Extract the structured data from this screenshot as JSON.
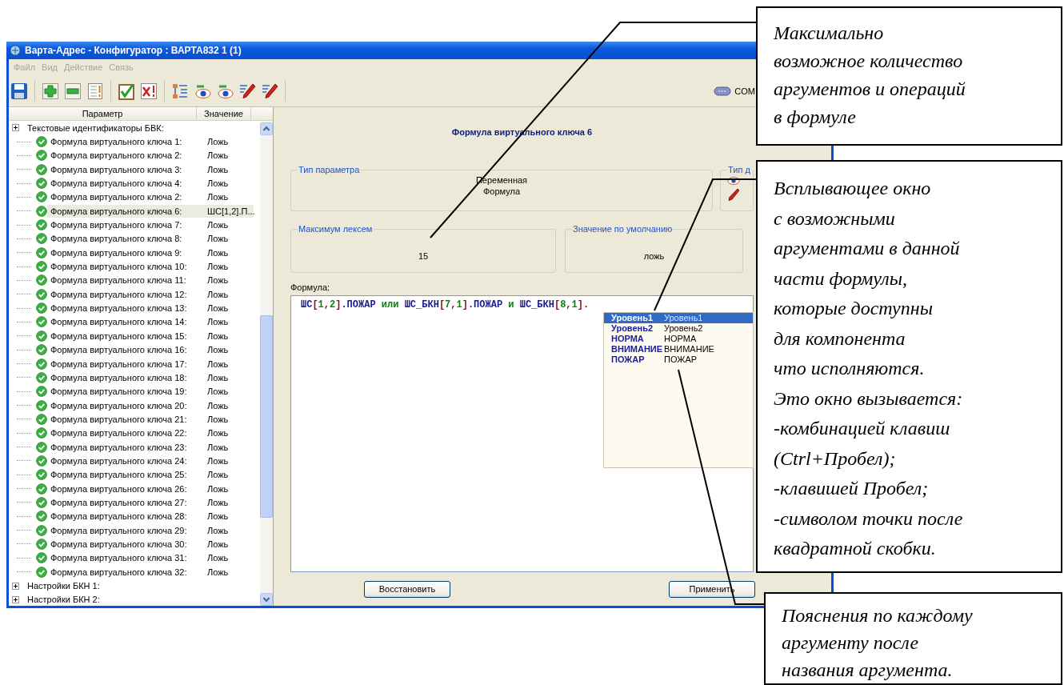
{
  "window": {
    "title": "Варта-Адрес - Конфигуратор : ВАРТА832 1 (1)"
  },
  "menu": [
    {
      "label": "Файл",
      "disabled": true
    },
    {
      "label": "Вид",
      "disabled": true
    },
    {
      "label": "Действие",
      "disabled": true
    },
    {
      "label": "Связь",
      "disabled": true
    }
  ],
  "toolbar": {
    "port": "COM"
  },
  "tree": {
    "columns": [
      "Параметр",
      "Значение"
    ],
    "rows": [
      {
        "kind": "group",
        "label": "Текстовые идентификаторы БВК:",
        "expanded": false
      },
      {
        "kind": "key",
        "label": "Формула виртуального ключа 1:",
        "value": "Ложь",
        "selected": false
      },
      {
        "kind": "key",
        "label": "Формула виртуального ключа 2:",
        "value": "Ложь",
        "selected": false
      },
      {
        "kind": "key",
        "label": "Формула виртуального ключа 3:",
        "value": "Ложь",
        "selected": false
      },
      {
        "kind": "key",
        "label": "Формула виртуального ключа 4:",
        "value": "Ложь",
        "selected": false
      },
      {
        "kind": "key",
        "label": "Формула виртуального ключа 2:",
        "value": "Ложь",
        "selected": false
      },
      {
        "kind": "key",
        "label": "Формула виртуального ключа 6:",
        "value": "ШС[1,2].П...",
        "selected": true
      },
      {
        "kind": "key",
        "label": "Формула виртуального ключа 7:",
        "value": "Ложь",
        "selected": false
      },
      {
        "kind": "key",
        "label": "Формула виртуального ключа 8:",
        "value": "Ложь",
        "selected": false
      },
      {
        "kind": "key",
        "label": "Формула виртуального ключа 9:",
        "value": "Ложь",
        "selected": false
      },
      {
        "kind": "key",
        "label": "Формула виртуального ключа 10:",
        "value": "Ложь",
        "selected": false
      },
      {
        "kind": "key",
        "label": "Формула виртуального ключа 11:",
        "value": "Ложь",
        "selected": false
      },
      {
        "kind": "key",
        "label": "Формула виртуального ключа 12:",
        "value": "Ложь",
        "selected": false
      },
      {
        "kind": "key",
        "label": "Формула виртуального ключа 13:",
        "value": "Ложь",
        "selected": false
      },
      {
        "kind": "key",
        "label": "Формула виртуального ключа 14:",
        "value": "Ложь",
        "selected": false
      },
      {
        "kind": "key",
        "label": "Формула виртуального ключа 15:",
        "value": "Ложь",
        "selected": false
      },
      {
        "kind": "key",
        "label": "Формула виртуального ключа 16:",
        "value": "Ложь",
        "selected": false
      },
      {
        "kind": "key",
        "label": "Формула виртуального ключа 17:",
        "value": "Ложь",
        "selected": false
      },
      {
        "kind": "key",
        "label": "Формула виртуального ключа 18:",
        "value": "Ложь",
        "selected": false
      },
      {
        "kind": "key",
        "label": "Формула виртуального ключа 19:",
        "value": "Ложь",
        "selected": false
      },
      {
        "kind": "key",
        "label": "Формула виртуального ключа 20:",
        "value": "Ложь",
        "selected": false
      },
      {
        "kind": "key",
        "label": "Формула виртуального ключа 21:",
        "value": "Ложь",
        "selected": false
      },
      {
        "kind": "key",
        "label": "Формула виртуального ключа 22:",
        "value": "Ложь",
        "selected": false
      },
      {
        "kind": "key",
        "label": "Формула виртуального ключа 23:",
        "value": "Ложь",
        "selected": false
      },
      {
        "kind": "key",
        "label": "Формула виртуального ключа 24:",
        "value": "Ложь",
        "selected": false
      },
      {
        "kind": "key",
        "label": "Формула виртуального ключа 25:",
        "value": "Ложь",
        "selected": false
      },
      {
        "kind": "key",
        "label": "Формула виртуального ключа 26:",
        "value": "Ложь",
        "selected": false
      },
      {
        "kind": "key",
        "label": "Формула виртуального ключа 27:",
        "value": "Ложь",
        "selected": false
      },
      {
        "kind": "key",
        "label": "Формула виртуального ключа 28:",
        "value": "Ложь",
        "selected": false
      },
      {
        "kind": "key",
        "label": "Формула виртуального ключа 29:",
        "value": "Ложь",
        "selected": false
      },
      {
        "kind": "key",
        "label": "Формула виртуального ключа 30:",
        "value": "Ложь",
        "selected": false
      },
      {
        "kind": "key",
        "label": "Формула виртуального ключа 31:",
        "value": "Ложь",
        "selected": false
      },
      {
        "kind": "key",
        "label": "Формула виртуального ключа 32:",
        "value": "Ложь",
        "selected": false
      },
      {
        "kind": "group",
        "label": "Настройки БКН 1:",
        "expanded": false
      },
      {
        "kind": "group",
        "label": "Настройки БКН 2:",
        "expanded": false
      }
    ]
  },
  "editor": {
    "heading": "Формула виртуального ключа 6",
    "param_type": {
      "label": "Тип параметра",
      "value": "Переменная\nФормула"
    },
    "access_type": {
      "label": "Тип д"
    },
    "max_tokens": {
      "label": "Максимум лексем",
      "value": "15"
    },
    "default_value": {
      "label": "Значение по умолчанию",
      "value": "ложь"
    },
    "formula": {
      "label": "Формула:",
      "tokens": [
        {
          "text": "ШС",
          "kind": "ident"
        },
        {
          "text": "[",
          "kind": "punct"
        },
        {
          "text": "1",
          "kind": "number"
        },
        {
          "text": ",",
          "kind": "punct"
        },
        {
          "text": "2",
          "kind": "number"
        },
        {
          "text": "]",
          "kind": "punct"
        },
        {
          "text": ".ПОЖАР",
          "kind": "ident"
        },
        {
          "text": " или ",
          "kind": "keyword"
        },
        {
          "text": "ШС_БКН",
          "kind": "ident"
        },
        {
          "text": "[",
          "kind": "punct"
        },
        {
          "text": "7",
          "kind": "number"
        },
        {
          "text": ",",
          "kind": "punct"
        },
        {
          "text": "1",
          "kind": "number"
        },
        {
          "text": "]",
          "kind": "punct"
        },
        {
          "text": ".ПОЖАР",
          "kind": "ident"
        },
        {
          "text": " и ",
          "kind": "keyword"
        },
        {
          "text": "ШС_БКН",
          "kind": "ident"
        },
        {
          "text": "[",
          "kind": "punct"
        },
        {
          "text": "8",
          "kind": "number"
        },
        {
          "text": ",",
          "kind": "punct"
        },
        {
          "text": "1",
          "kind": "number"
        },
        {
          "text": "]",
          "kind": "punct"
        },
        {
          "text": ".",
          "kind": "punct"
        }
      ]
    },
    "completion": [
      {
        "name": "Уровень1",
        "hint": "Уровень1",
        "selected": true
      },
      {
        "name": "Уровень2",
        "hint": "Уровень2",
        "selected": false
      },
      {
        "name": "НОРМА",
        "hint": "НОРМА",
        "selected": false
      },
      {
        "name": "ВНИМАНИЕ",
        "hint": "ВНИМАНИЕ",
        "selected": false
      },
      {
        "name": "ПОЖАР",
        "hint": "ПОЖАР",
        "selected": false
      }
    ],
    "buttons": [
      {
        "label": "Восстановить"
      },
      {
        "label": "Применить"
      }
    ]
  },
  "callouts": [
    {
      "text": "Максимально\nвозможное количество\nаргументов и операций\nв формуле"
    },
    {
      "text": "Всплывающее окно\nс возможными\nаргументами в данной\nчасти формулы,\nкоторые доступны\nдля компонента\nчто исполняются.\nЭто окно вызывается:\n-комбинацией клавиш\n(Ctrl+Пробел);\n-клавишей Пробел;\n-символом точки после\nквадратной скобки."
    },
    {
      "text": "Пояснения по каждому\nаргументу после\nназвания аргумента."
    }
  ]
}
